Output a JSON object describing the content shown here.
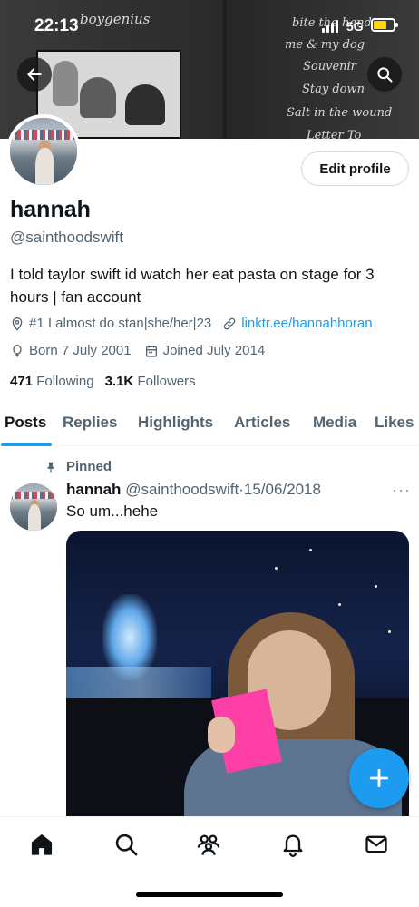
{
  "status_bar": {
    "time": "22:13",
    "network": "5G"
  },
  "banner": {
    "script_lines": [
      "boygenius",
      "bite the hand",
      "me & my dog",
      "Souvenir",
      "Stay down",
      "Salt in the wound",
      "Letter To"
    ]
  },
  "header": {
    "back_icon": "arrow-left-icon",
    "search_icon": "search-icon"
  },
  "profile": {
    "edit_profile_label": "Edit profile",
    "name": "hannah",
    "handle": "@sainthoodswift",
    "bio": "I told taylor swift id watch her eat pasta on stage for 3 hours | fan account",
    "location": "#1 I almost do stan|she/her|23",
    "link": "linktr.ee/hannahhoran",
    "born": "Born 7 July 2001",
    "joined": "Joined July 2014",
    "following_count": "471",
    "following_label": "Following",
    "followers_count": "3.1K",
    "followers_label": "Followers"
  },
  "tabs": [
    "Posts",
    "Replies",
    "Highlights",
    "Articles",
    "Media",
    "Likes"
  ],
  "active_tab": "Posts",
  "tweet": {
    "pinned_label": "Pinned",
    "name": "hannah",
    "handle": "@sainthoodswift",
    "separator": "·",
    "date": "15/06/2018",
    "text": "So um...hehe",
    "more": "···"
  },
  "bottom_nav": [
    "home-icon",
    "search-icon",
    "communities-icon",
    "notifications-icon",
    "messages-icon"
  ],
  "colors": {
    "accent": "#1d9bf0",
    "text": "#0f1419",
    "secondary": "#536471",
    "pink_card": "#ff3fa8"
  }
}
